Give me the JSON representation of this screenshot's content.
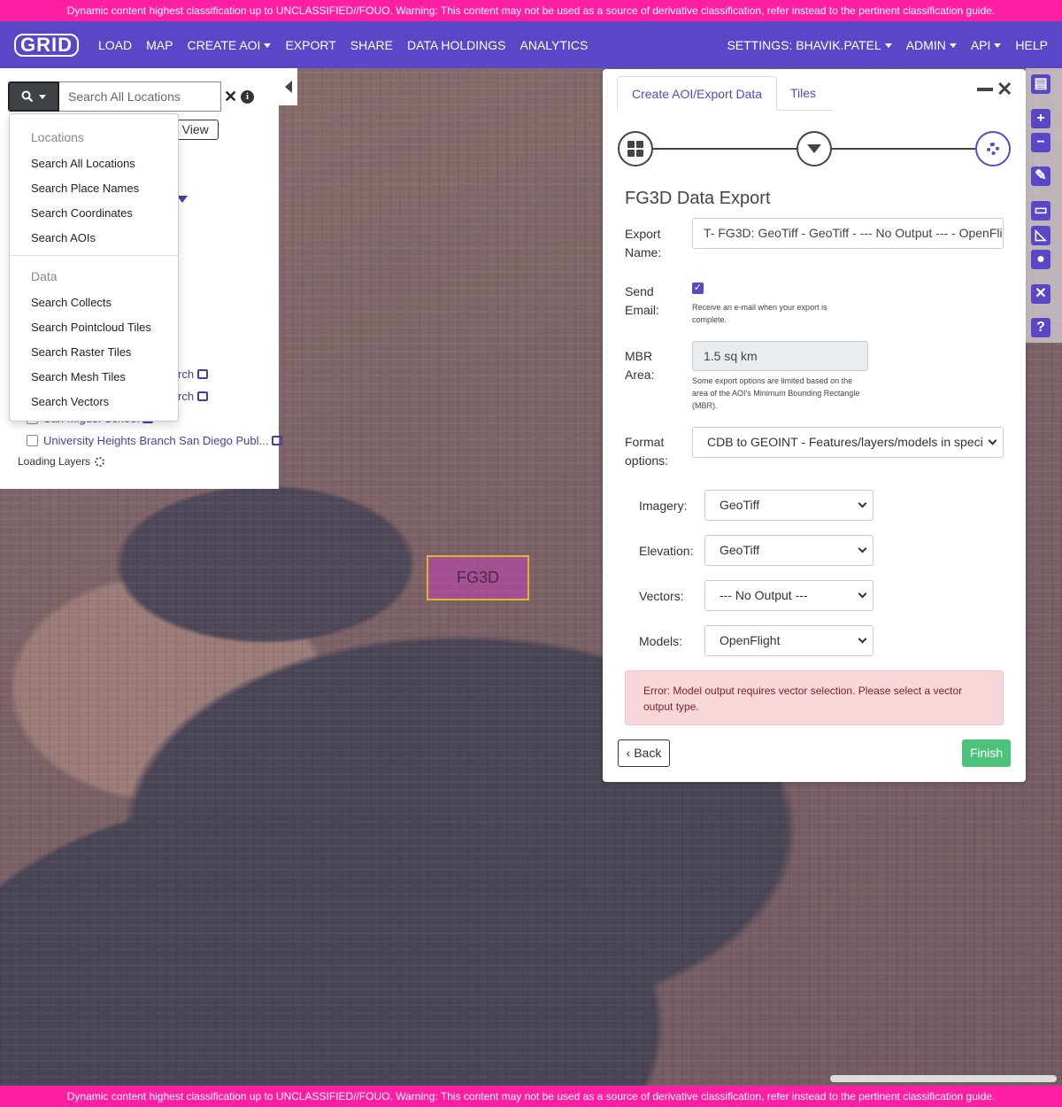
{
  "banner": {
    "text": "Dynamic content highest classification up to UNCLASSIFIED//FOUO. Warning: This content may not be used as a source of derivative classification, refer instead to the pertinent classification guide.",
    "color": "#ff1fa3"
  },
  "navbar": {
    "logo": "GRID",
    "items": [
      "LOAD",
      "MAP",
      "CREATE AOI",
      "EXPORT",
      "SHARE",
      "DATA HOLDINGS",
      "ANALYTICS"
    ],
    "right_items": [
      "SETTINGS: BHAVIK.PATEL",
      "ADMIN",
      "API",
      "HELP"
    ],
    "color": "#5a47c8"
  },
  "search": {
    "placeholder": "Search All Locations",
    "view_button_partial": "e View",
    "dropdown": {
      "locations_header": "Locations",
      "locations_items": [
        "Search All Locations",
        "Search Place Names",
        "Search Coordinates",
        "Search AOIs"
      ],
      "data_header": "Data",
      "data_items": [
        "Search Collects",
        "Search Pointcloud Tiles",
        "Search Raster Tiles",
        "Search Mesh Tiles",
        "Search Vectors"
      ]
    }
  },
  "layers": {
    "partial_1": "rch",
    "partial_2": "rch",
    "item_1": "San Miguel School",
    "item_2": "University Heights Branch San Diego Publ...",
    "loading": "Loading Layers"
  },
  "map": {
    "aoi_label": "FG3D"
  },
  "export_panel": {
    "tabs": [
      "Create AOI/Export Data",
      "Tiles"
    ],
    "title": "FG3D Data Export",
    "export_name_label": "Export Name:",
    "export_name_value": "T- FG3D: GeoTiff - GeoTiff - --- No Output --- - OpenFlig",
    "send_email_label": "Send Email:",
    "send_email_checked": true,
    "send_email_help": "Receive an e-mail when your export is complete.",
    "mbr_label": "MBR Area:",
    "mbr_value": "1.5 sq km",
    "mbr_help": "Some export options are limited based on the area of the AOI's Minimum Bounding Rectangle (MBR).",
    "format_label": "Format options:",
    "format_value": "CDB to GEOINT - Features/layers/models in speci",
    "imagery_label": "Imagery:",
    "imagery_value": "GeoTiff",
    "elevation_label": "Elevation:",
    "elevation_value": "GeoTiff",
    "vectors_label": "Vectors:",
    "vectors_value": "--- No Output ---",
    "models_label": "Models:",
    "models_value": "OpenFlight",
    "error": "Error: Model output requires vector selection. Please select a vector output type.",
    "back_label": "Back",
    "finish_label": "Finish"
  },
  "toolbar": {
    "icons": [
      "map-icon",
      "zoom-in-icon",
      "zoom-out-icon",
      "edit-icon",
      "ruler-icon",
      "area-measure-icon",
      "location-pin-icon",
      "close-icon",
      "help-icon"
    ]
  }
}
